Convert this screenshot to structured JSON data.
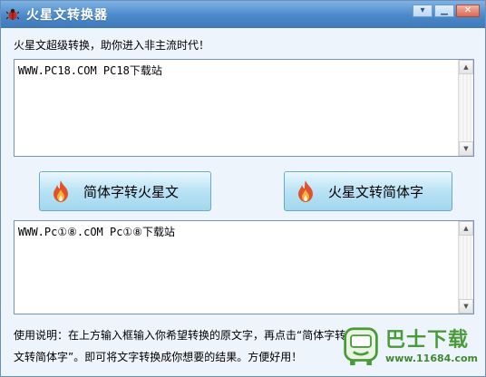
{
  "window": {
    "title": "火星文转换器",
    "controls": {
      "menu_icon": "dropdown-icon",
      "minimize_icon": "minimize-icon",
      "close_icon": "close-icon"
    }
  },
  "main": {
    "hint": "火星文超级转换，助你进入非主流时代！",
    "input_text": "WWW.PC18.COM PC18下载站",
    "output_text": "WWW.Pc①⑧.cOM Pc①⑧下载站",
    "buttons": {
      "to_martian": "简体字转火星文",
      "to_simplified": "火星文转简体字",
      "icon": "flame-icon"
    },
    "usage": {
      "line1": "使用说明：在上方输入框输入你希望转换的原文字，再点击“简体字转",
      "line2": "文转简体字”。即可将文字转换成你想要的结果。方便好用！"
    }
  },
  "watermark": {
    "name": "巴士下载",
    "url": "www.11684.com"
  },
  "colors": {
    "titlebar": "#4b88c9",
    "button_face": "#b9e2f5",
    "flame": "#e0522b",
    "watermark_green": "#4a9a3a"
  }
}
